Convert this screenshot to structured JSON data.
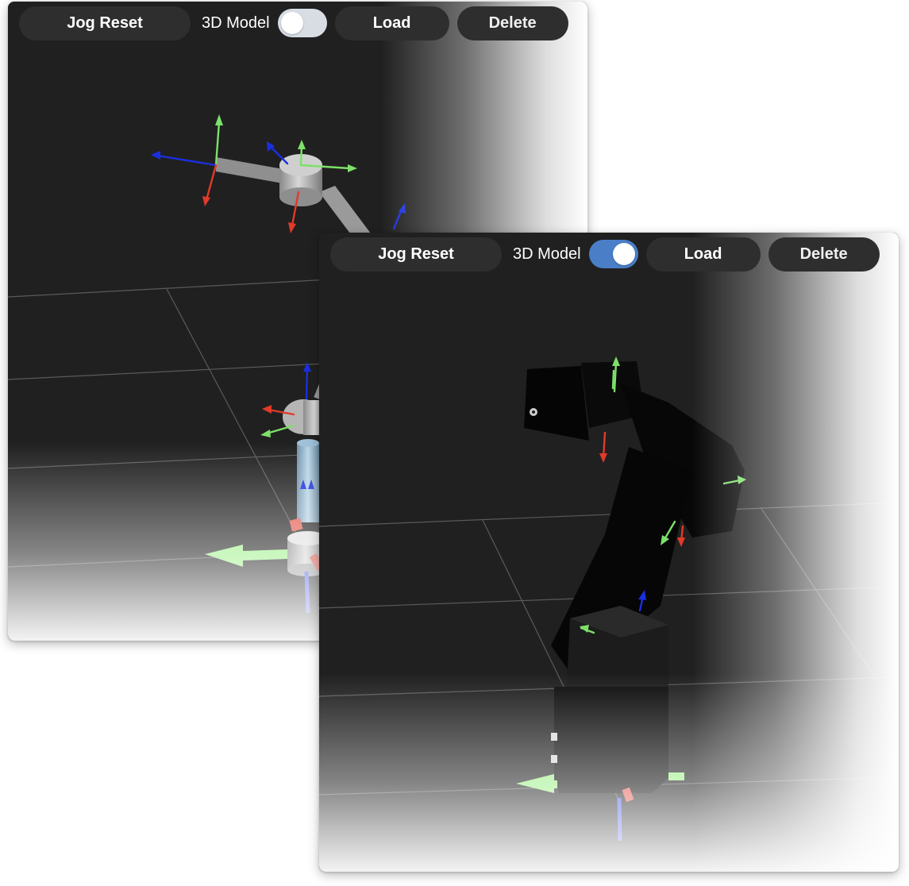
{
  "panels": {
    "back": {
      "toolbar": {
        "jog_reset_label": "Jog Reset",
        "model_toggle_label": "3D Model",
        "model_toggle_state": "off",
        "load_label": "Load",
        "delete_label": "Delete"
      },
      "viewport": {
        "render": "skeleton",
        "background": "#202020"
      }
    },
    "front": {
      "toolbar": {
        "jog_reset_label": "Jog Reset",
        "model_toggle_label": "3D Model",
        "model_toggle_state": "on",
        "load_label": "Load",
        "delete_label": "Delete"
      },
      "viewport": {
        "render": "solid-model",
        "background": "#202020"
      }
    }
  },
  "colors": {
    "axis_x": "#e03a2a",
    "axis_y": "#7de06a",
    "axis_z": "#1a2fe0",
    "toggle_on": "#4a7fc8",
    "toggle_off": "#d8dde4",
    "button_bg": "#2e2e2e"
  },
  "icons": [
    "axis-gizmo-icon",
    "toggle-switch-icon"
  ]
}
